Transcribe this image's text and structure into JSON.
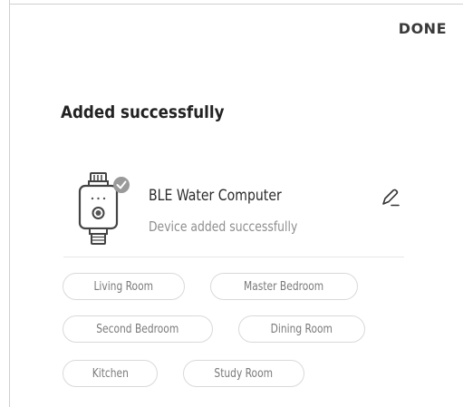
{
  "header": {
    "done_label": "DONE"
  },
  "main": {
    "title": "Added successfully"
  },
  "device": {
    "name": "BLE Water Computer",
    "status": "Device added successfully",
    "icon": "water-timer-device-icon",
    "badge_icon": "check-badge-icon",
    "edit_icon": "pencil-icon"
  },
  "rooms": [
    {
      "label": "Living Room"
    },
    {
      "label": "Master Bedroom"
    },
    {
      "label": "Second Bedroom"
    },
    {
      "label": "Dining Room"
    },
    {
      "label": "Kitchen"
    },
    {
      "label": "Study Room"
    }
  ],
  "colors": {
    "text": "#222222",
    "muted": "#8f8f8f",
    "chip_border": "#d9d9d9",
    "badge": "#9a9a9a"
  }
}
